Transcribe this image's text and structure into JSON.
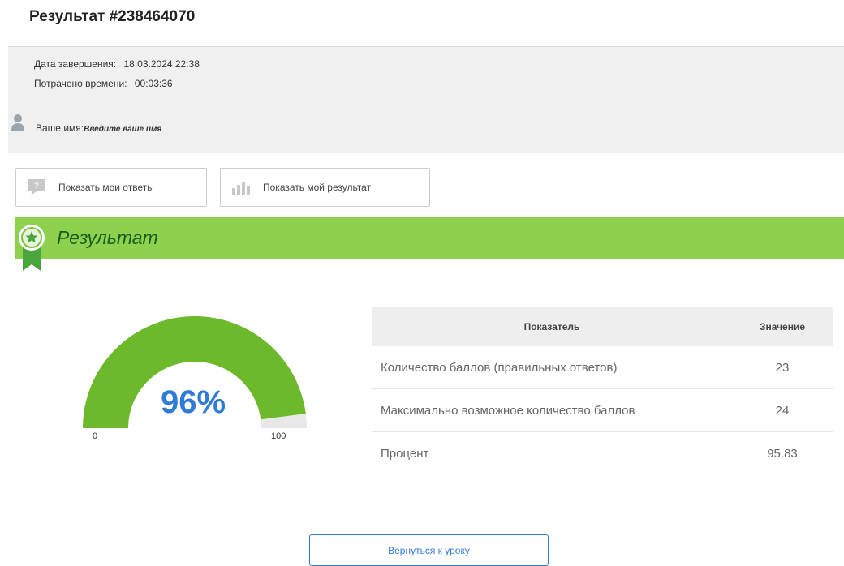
{
  "header": {
    "title": "Результат #238464070"
  },
  "info": {
    "finished_label": "Дата завершения:",
    "finished_value": "18.03.2024 22:38",
    "spent_label": "Потрачено времени:",
    "spent_value": "00:03:36"
  },
  "user": {
    "name_label": "Ваше имя:",
    "name_value": "Введите ваше имя"
  },
  "buttons": {
    "show_answers": "Показать мои ответы",
    "show_result": "Показать мой результат",
    "back_to_lesson": "Вернуться к уроку"
  },
  "banner": {
    "title": "Результат"
  },
  "gauge": {
    "value_text": "96%",
    "percent": 95.83,
    "min": "0",
    "max": "100",
    "fill_color": "#6cba2c",
    "track_color": "#e8e8e8"
  },
  "table": {
    "headers": [
      "Показатель",
      "Значение"
    ],
    "rows": [
      {
        "label": "Количество баллов (правильных ответов)",
        "value": "23"
      },
      {
        "label": "Максимально возможное количество баллов",
        "value": "24"
      },
      {
        "label": "Процент",
        "value": "95.83"
      }
    ]
  },
  "colors": {
    "accent": "#2f7bd6",
    "banner": "#8dd14f",
    "banner_text": "#1b5d1b"
  }
}
